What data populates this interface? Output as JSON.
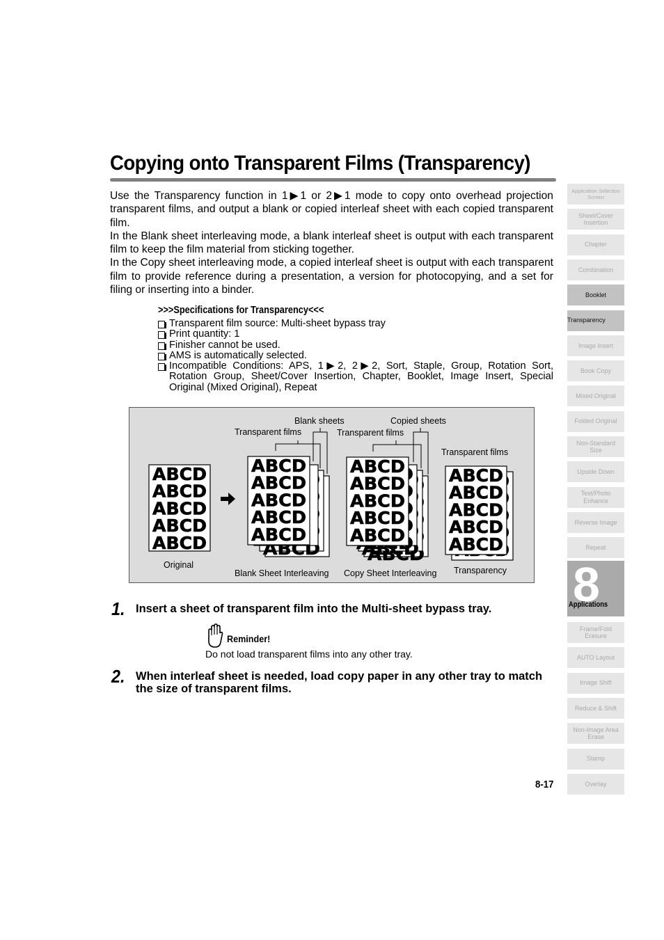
{
  "page": {
    "title": "Copying onto Transparent Films (Transparency)",
    "intro": [
      "Use the Transparency function in 1▶1 or 2▶1 mode to copy onto overhead projection transparent films, and output a blank or copied interleaf sheet with each copied transparent film.",
      "In the Blank sheet interleaving mode, a blank interleaf sheet is output with each transparent film to keep the film material from sticking together.",
      "In the Copy sheet interleaving mode, a copied interleaf sheet is output with each transparent film to provide reference during a presentation, a version for photocopying, and a set for filing or inserting into a binder."
    ],
    "specifications": {
      "heading": ">>>Specifications for Transparency<<<",
      "items": [
        "Transparent film source: Multi-sheet bypass tray",
        "Print quantity: 1",
        "Finisher cannot be used.",
        "AMS is automatically selected.",
        "Incompatible Conditions: APS, 1▶2, 2▶2, Sort, Staple, Group, Rotation Sort, Rotation Group, Sheet/Cover Insertion, Chapter, Booklet, Image Insert, Special Original (Mixed Original), Repeat"
      ]
    },
    "diagram": {
      "sheet_text": "ABCD",
      "rows": 5,
      "labels": {
        "original": "Original",
        "blank_interleaving": "Blank Sheet Interleaving",
        "copy_interleaving": "Copy Sheet Interleaving",
        "transparency": "Transparency",
        "blank_sheets": "Blank sheets",
        "copied_sheets": "Copied sheets",
        "transparent_films_1": "Transparent films",
        "transparent_films_2": "Transparent films",
        "transparent_films_3": "Transparent films"
      }
    },
    "steps": [
      {
        "number": "1.",
        "text": "Insert a sheet of transparent film into the Multi-sheet bypass tray."
      },
      {
        "number": "2.",
        "text": "When interleaf sheet is needed, load copy paper in any other tray to match the size of transparent films."
      }
    ],
    "reminder": {
      "label": "Reminder!",
      "text": "Do not load transparent films into any other tray."
    },
    "page_number": "8-17"
  },
  "sidebar": {
    "tabs": [
      {
        "label": "Application Selection Screen",
        "state": "inactive"
      },
      {
        "label": "Sheet/Cover Insertion",
        "state": "inactive"
      },
      {
        "label": "Chapter",
        "state": "inactive"
      },
      {
        "label": "Combination",
        "state": "inactive"
      },
      {
        "label": "Booklet",
        "state": "highlight"
      },
      {
        "label": "Transparency",
        "state": "active"
      },
      {
        "label": "Image Insert",
        "state": "inactive"
      },
      {
        "label": "Book Copy",
        "state": "inactive"
      },
      {
        "label": "Mixed Original",
        "state": "inactive"
      },
      {
        "label": "Folded Original",
        "state": "inactive"
      },
      {
        "label": "Non-Standard Size",
        "state": "inactive"
      },
      {
        "label": "Upside Down",
        "state": "inactive"
      },
      {
        "label": "Text/Photo Enhance",
        "state": "inactive"
      },
      {
        "label": "Reverse Image",
        "state": "inactive"
      },
      {
        "label": "Repeat",
        "state": "inactive"
      },
      {
        "label": "Frame/Fold Erasure",
        "state": "inactive"
      },
      {
        "label": "AUTO Layout",
        "state": "inactive"
      },
      {
        "label": "Image Shift",
        "state": "inactive"
      },
      {
        "label": "Reduce & Shift",
        "state": "inactive"
      },
      {
        "label": "Non-Image Area Erase",
        "state": "inactive"
      },
      {
        "label": "Stamp",
        "state": "inactive"
      },
      {
        "label": "Overlay",
        "state": "inactive"
      }
    ],
    "chapter": {
      "number": "8",
      "label": "Applications"
    }
  }
}
